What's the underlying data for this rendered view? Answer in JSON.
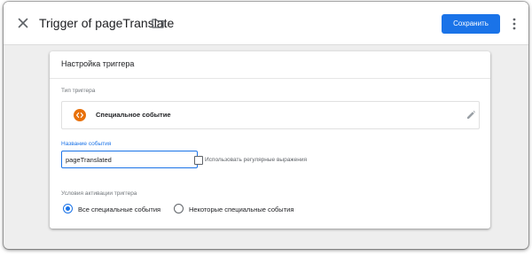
{
  "header": {
    "close_icon": "close-icon",
    "title": "Trigger of pageTranslate",
    "folder_icon": "folder-icon",
    "save_label": "Сохранить",
    "more_icon": "more-vert-icon"
  },
  "trigger_config": {
    "card_title": "Настройка триггера",
    "type_section_label": "Тип триггера",
    "type": {
      "icon": "custom-event-icon",
      "name": "Специальное событие",
      "edit_icon": "pencil-icon"
    },
    "event_name": {
      "label": "Название события",
      "value": "pageTranslated"
    },
    "use_regex": {
      "label": "Использовать регулярные выражения",
      "checked": false
    },
    "activation": {
      "label": "Условия активации триггера",
      "options": [
        {
          "label": "Все специальные события",
          "selected": true
        },
        {
          "label": "Некоторые специальные события",
          "selected": false
        }
      ]
    }
  },
  "colors": {
    "accent": "#1a73e8",
    "event_icon": "#e8710a",
    "background": "#eeeeee"
  }
}
